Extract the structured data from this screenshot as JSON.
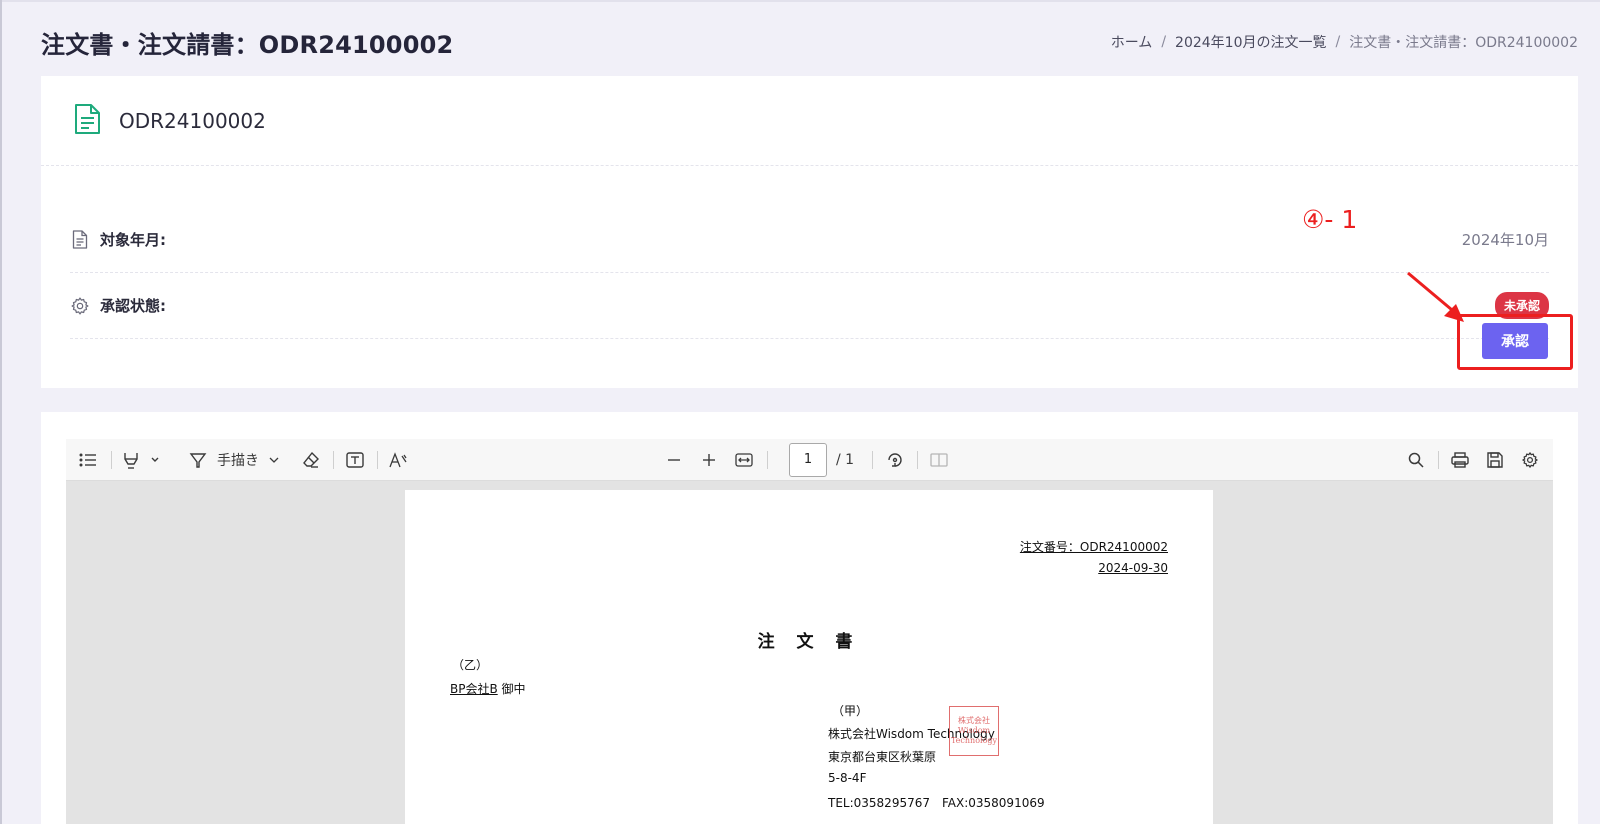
{
  "page": {
    "title": "注文書・注文請書：ODR24100002"
  },
  "breadcrumb": {
    "home": "ホーム",
    "list": "2024年10月の注文一覧",
    "current": "注文書・注文請書：ODR24100002",
    "separator": "/"
  },
  "document": {
    "id": "ODR24100002",
    "fields": {
      "target_month_label": "対象年月:",
      "target_month_value": "2024年10月",
      "approval_status_label": "承認状態:",
      "approval_status_value": "未承認"
    },
    "approve_button": "承認"
  },
  "annotation": {
    "label": "④- 1",
    "color": "#ec1f1f"
  },
  "viewer_toolbar": {
    "handwriting_label": "手描き",
    "page_current": "1",
    "page_total": "/ 1",
    "icons": [
      "list-icon",
      "highlighter-icon",
      "pen-icon",
      "eraser-icon",
      "text-box-icon",
      "font-size-icon",
      "zoom-out-icon",
      "zoom-in-icon",
      "fit-width-icon",
      "rotate-icon",
      "page-layout-icon",
      "search-icon",
      "print-icon",
      "save-icon",
      "settings-icon"
    ]
  },
  "pdf": {
    "order_number": "注文番号：ODR24100002",
    "order_date": "2024-09-30",
    "doc_title": "注 文 書",
    "recipient_tag": "（乙）",
    "recipient_name": "BP会社B",
    "recipient_honorific": "御中",
    "issuer_tag": "（甲）",
    "issuer_company": "株式会社Wisdom Technology",
    "issuer_address1": "東京都台東区秋葉原",
    "issuer_address2": "5-8-4F",
    "issuer_tel_fax": "TEL:0358295767　FAX:0358091069",
    "seal_text": [
      "株式会社",
      "Wisdom",
      "Technology"
    ]
  },
  "colors": {
    "accent": "#6c63f0",
    "badge_danger": "#dc3545",
    "doc_icon": "#1eaa7c",
    "background": "#f1f0f8"
  }
}
